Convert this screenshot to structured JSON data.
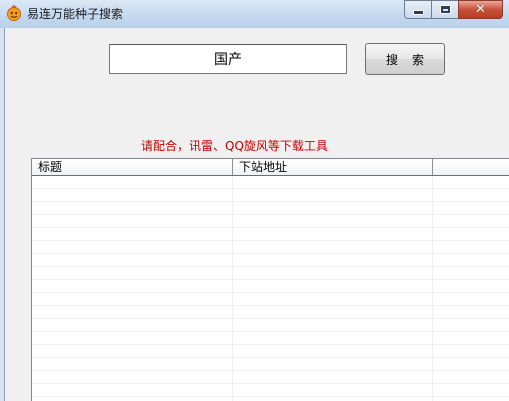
{
  "window": {
    "title": "易连万能种子搜索",
    "close_glyph": "✕"
  },
  "search": {
    "value": "国产",
    "button_label": "搜索"
  },
  "notice": "请配合，讯雷、QQ旋风等下载工具",
  "colors": {
    "notice": "#c00000",
    "titlebar": "#c5d9ef",
    "close_button": "#c8523a"
  },
  "table": {
    "columns": [
      "标题",
      "下站地址",
      ""
    ],
    "rows": []
  }
}
